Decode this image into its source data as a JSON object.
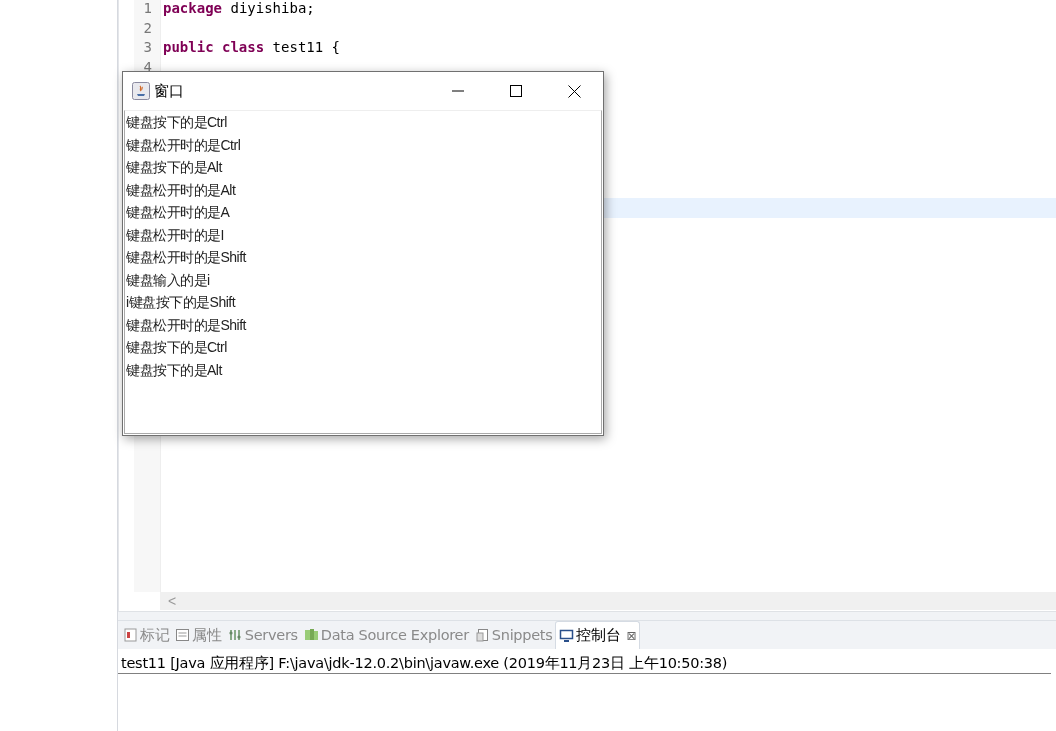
{
  "editor": {
    "lines": [
      {
        "number": "1",
        "tokens": [
          {
            "kind": "keyword",
            "text": "package"
          },
          {
            "kind": "plain",
            "text": "diyishiba;"
          }
        ]
      },
      {
        "number": "2"
      },
      {
        "number": "3",
        "tokens": [
          {
            "kind": "keyword",
            "text": "public"
          },
          {
            "kind": "keyword",
            "text": "class"
          },
          {
            "kind": "plain",
            "text": "test11 {"
          }
        ]
      },
      {
        "number": "4"
      }
    ],
    "scroll_arrow": "<"
  },
  "app_window": {
    "title": "窗口",
    "output_lines": [
      "键盘按下的是Ctrl",
      "键盘松开时的是Ctrl",
      "键盘按下的是Alt",
      "键盘松开时的是Alt",
      "键盘松开时的是A",
      "键盘松开时的是I",
      "键盘松开时的是Shift",
      "键盘输入的是i",
      "i键盘按下的是Shift",
      "键盘松开时的是Shift",
      "键盘按下的是Ctrl",
      "键盘按下的是Alt"
    ]
  },
  "panel": {
    "tabs": [
      {
        "label": "标记",
        "selected": false
      },
      {
        "label": "属性",
        "selected": false
      },
      {
        "label": "Servers",
        "selected": false
      },
      {
        "label": "Data Source Explorer",
        "selected": false
      },
      {
        "label": "Snippets",
        "selected": false
      },
      {
        "label": "控制台",
        "selected": true,
        "close": "⊠"
      }
    ],
    "console_header": "test11 [Java 应用程序] F:\\java\\jdk-12.0.2\\bin\\javaw.exe  (2019年11月23日 上午10:50:38)"
  }
}
